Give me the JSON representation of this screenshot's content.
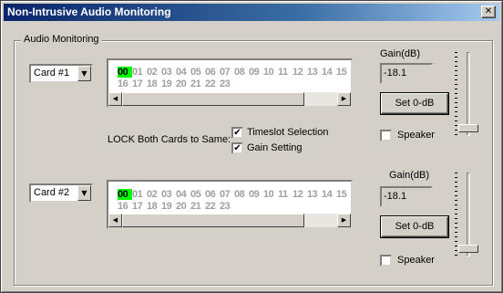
{
  "window": {
    "title": "Non-Intrusive Audio Monitoring",
    "close_label": "✕"
  },
  "group": {
    "label": "Audio Monitoring"
  },
  "lock": {
    "label": "LOCK Both Cards to Same:",
    "timeslot_label": "Timeslot Selection",
    "timeslot_checked": true,
    "gain_label": "Gain Setting",
    "gain_checked": true
  },
  "cards": [
    {
      "card_select": "Card #1",
      "timeslots_row1": [
        "00",
        "01",
        "02",
        "03",
        "04",
        "05",
        "06",
        "07",
        "08",
        "09",
        "10",
        "11",
        "12",
        "13",
        "14",
        "15"
      ],
      "timeslots_row2": [
        "16",
        "17",
        "18",
        "19",
        "20",
        "21",
        "22",
        "23"
      ],
      "active_slot": "00",
      "gain_label": "Gain(dB)",
      "gain_value": "-18.1",
      "set_button": "Set 0-dB",
      "speaker_label": "Speaker",
      "speaker_checked": false,
      "slider_level": 0.95
    },
    {
      "card_select": "Card #2",
      "timeslots_row1": [
        "00",
        "01",
        "02",
        "03",
        "04",
        "05",
        "06",
        "07",
        "08",
        "09",
        "10",
        "11",
        "12",
        "13",
        "14",
        "15"
      ],
      "timeslots_row2": [
        "16",
        "17",
        "18",
        "19",
        "20",
        "21",
        "22",
        "23"
      ],
      "active_slot": "00",
      "gain_label": "Gain(dB)",
      "gain_value": "-18.1",
      "set_button": "Set 0-dB",
      "speaker_label": "Speaker",
      "speaker_checked": false,
      "slider_level": 0.95
    }
  ],
  "icons": {
    "dropdown": "▼",
    "scroll_left": "◀",
    "scroll_right": "▶",
    "check": "✔"
  }
}
